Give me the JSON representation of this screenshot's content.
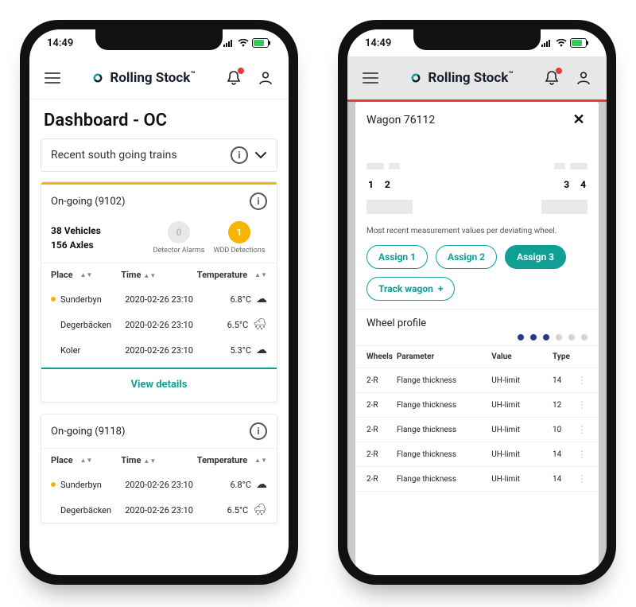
{
  "statusbar": {
    "time": "14:49"
  },
  "brand": {
    "name": "Rolling Stock",
    "tm": "™"
  },
  "phone1": {
    "page_title": "Dashboard - OC",
    "dropdown_label": "Recent south going trains",
    "cards": [
      {
        "head": "On-going (9102)",
        "vehicles_line": "38 Vehicles",
        "axles_line": "156 Axles",
        "detector_count": "0",
        "detector_label": "Detector Alarms",
        "wdd_count": "1",
        "wdd_label": "WDD Detections",
        "columns": {
          "place": "Place",
          "time": "Time",
          "temp": "Temperature"
        },
        "rows": [
          {
            "dot": true,
            "place": "Sunderbyn",
            "time": "2020-02-26 23:10",
            "temp": "6.8°C",
            "weather": "cloud"
          },
          {
            "dot": false,
            "place": "Degerbäcken",
            "time": "2020-02-26 23:10",
            "temp": "6.5°C",
            "weather": "rain"
          },
          {
            "dot": false,
            "place": "Koler",
            "time": "2020-02-26 23:10",
            "temp": "5.3°C",
            "weather": "cloud"
          }
        ],
        "view_details": "View details"
      },
      {
        "head": "On-going (9118)",
        "columns": {
          "place": "Place",
          "time": "Time",
          "temp": "Temperature"
        },
        "rows": [
          {
            "dot": true,
            "place": "Sunderbyn",
            "time": "2020-02-26 23:10",
            "temp": "6.8°C",
            "weather": "cloud"
          },
          {
            "dot": false,
            "place": "Degerbäcken",
            "time": "2020-02-26 23:10",
            "temp": "6.5°C",
            "weather": "rain"
          }
        ]
      }
    ]
  },
  "phone2": {
    "modal_title": "Wagon 76112",
    "wheel_nums": [
      "1",
      "2",
      "3",
      "4"
    ],
    "caption": "Most recent measurement values per deviating wheel.",
    "assign_buttons": [
      "Assign 1",
      "Assign 2",
      "Assign 3"
    ],
    "track_btn": "Track wagon",
    "section_title": "Wheel profile",
    "wp_columns": {
      "wheels": "Wheels",
      "param": "Parameter",
      "value": "Value",
      "type": "Type"
    },
    "wp_rows": [
      {
        "wh": "2-R",
        "par": "Flange thickness",
        "val": "UH-limit",
        "type": "14"
      },
      {
        "wh": "2-R",
        "par": "Flange thickness",
        "val": "UH-limit",
        "type": "12"
      },
      {
        "wh": "2-R",
        "par": "Flange thickness",
        "val": "UH-limit",
        "type": "10"
      },
      {
        "wh": "2-R",
        "par": "Flange thickness",
        "val": "UH-limit",
        "type": "14"
      },
      {
        "wh": "2-R",
        "par": "Flange thickness",
        "val": "UH-limit",
        "type": "14"
      }
    ]
  }
}
